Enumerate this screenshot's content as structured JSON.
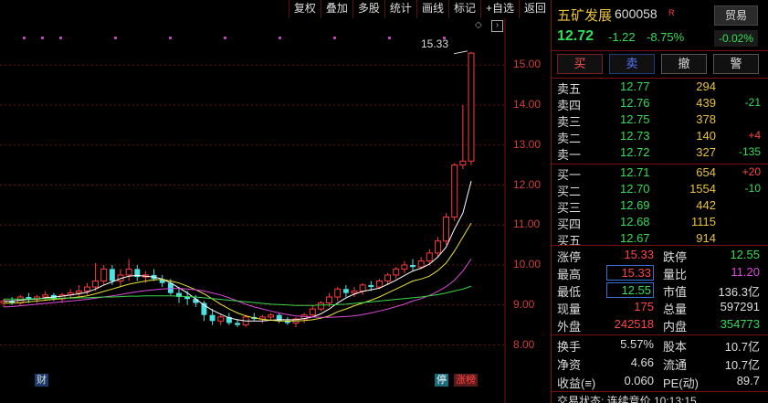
{
  "toolbar": [
    "复权",
    "叠加",
    "多股",
    "统计",
    "画线",
    "标记",
    "+自选",
    "返回"
  ],
  "chart_data": {
    "type": "candlestick",
    "ylim": [
      7.6,
      15.6
    ],
    "yticks": [
      "15.00",
      "14.00",
      "13.00",
      "12.00",
      "11.00",
      "10.00",
      "9.00",
      "8.00"
    ],
    "high_label": "15.33",
    "markers": {
      "cai": "财",
      "ting": "停",
      "zhangbang": "涨榜"
    },
    "ohlc": [
      [
        9.05,
        9.15,
        8.95,
        9.1
      ],
      [
        9.1,
        9.2,
        9.0,
        9.05
      ],
      [
        9.05,
        9.25,
        9.0,
        9.2
      ],
      [
        9.2,
        9.3,
        9.05,
        9.15
      ],
      [
        9.15,
        9.25,
        9.05,
        9.2
      ],
      [
        9.2,
        9.35,
        9.1,
        9.25
      ],
      [
        9.25,
        9.3,
        9.1,
        9.15
      ],
      [
        9.15,
        9.3,
        9.05,
        9.25
      ],
      [
        9.25,
        9.4,
        9.15,
        9.3
      ],
      [
        9.3,
        9.5,
        9.2,
        9.35
      ],
      [
        9.35,
        9.55,
        9.25,
        9.45
      ],
      [
        9.45,
        10.05,
        9.35,
        9.6
      ],
      [
        9.6,
        10.0,
        9.5,
        9.9
      ],
      [
        9.9,
        10.0,
        9.5,
        9.6
      ],
      [
        9.6,
        9.9,
        9.45,
        9.75
      ],
      [
        9.75,
        10.15,
        9.6,
        9.9
      ],
      [
        9.9,
        10.0,
        9.6,
        9.7
      ],
      [
        9.7,
        9.85,
        9.55,
        9.75
      ],
      [
        9.75,
        9.9,
        9.6,
        9.65
      ],
      [
        9.65,
        9.75,
        9.45,
        9.55
      ],
      [
        9.55,
        9.65,
        9.25,
        9.3
      ],
      [
        9.3,
        9.45,
        9.05,
        9.2
      ],
      [
        9.2,
        9.35,
        9.0,
        9.15
      ],
      [
        9.15,
        9.25,
        8.95,
        9.05
      ],
      [
        9.05,
        9.1,
        8.6,
        8.75
      ],
      [
        8.75,
        8.9,
        8.5,
        8.6
      ],
      [
        8.6,
        8.75,
        8.5,
        8.7
      ],
      [
        8.7,
        8.8,
        8.5,
        8.55
      ],
      [
        8.55,
        8.65,
        8.45,
        8.5
      ],
      [
        8.5,
        8.75,
        8.45,
        8.7
      ],
      [
        8.7,
        8.8,
        8.6,
        8.65
      ],
      [
        8.65,
        8.75,
        8.55,
        8.7
      ],
      [
        8.7,
        8.8,
        8.6,
        8.75
      ],
      [
        8.75,
        8.8,
        8.55,
        8.6
      ],
      [
        8.6,
        8.7,
        8.5,
        8.55
      ],
      [
        8.55,
        8.7,
        8.45,
        8.65
      ],
      [
        8.65,
        8.8,
        8.55,
        8.75
      ],
      [
        8.75,
        9.0,
        8.7,
        8.9
      ],
      [
        8.9,
        9.1,
        8.85,
        9.05
      ],
      [
        9.05,
        9.3,
        8.95,
        9.2
      ],
      [
        9.2,
        9.45,
        9.1,
        9.4
      ],
      [
        9.4,
        9.5,
        9.2,
        9.3
      ],
      [
        9.3,
        9.45,
        9.2,
        9.35
      ],
      [
        9.35,
        9.55,
        9.25,
        9.5
      ],
      [
        9.5,
        9.6,
        9.35,
        9.45
      ],
      [
        9.45,
        9.65,
        9.4,
        9.6
      ],
      [
        9.6,
        9.8,
        9.5,
        9.75
      ],
      [
        9.75,
        9.95,
        9.65,
        9.9
      ],
      [
        9.9,
        10.1,
        9.8,
        10.0
      ],
      [
        10.0,
        10.15,
        9.85,
        9.95
      ],
      [
        9.95,
        10.2,
        9.9,
        10.1
      ],
      [
        10.1,
        10.4,
        10.0,
        10.3
      ],
      [
        10.3,
        10.7,
        10.2,
        10.6
      ],
      [
        10.6,
        11.3,
        10.5,
        11.2
      ],
      [
        11.2,
        12.55,
        11.1,
        12.5
      ],
      [
        12.5,
        14.0,
        12.4,
        12.6
      ],
      [
        12.6,
        15.33,
        12.5,
        15.3
      ]
    ],
    "ma": {
      "ma5": {
        "color": "#ffffff",
        "values": [
          9.1,
          9.1,
          9.12,
          9.14,
          9.15,
          9.18,
          9.2,
          9.22,
          9.25,
          9.28,
          9.32,
          9.4,
          9.5,
          9.58,
          9.66,
          9.72,
          9.74,
          9.72,
          9.7,
          9.65,
          9.55,
          9.43,
          9.3,
          9.15,
          9.0,
          8.87,
          8.77,
          8.68,
          8.63,
          8.6,
          8.6,
          8.6,
          8.62,
          8.63,
          8.63,
          8.63,
          8.66,
          8.7,
          8.78,
          8.9,
          9.05,
          9.18,
          9.27,
          9.34,
          9.38,
          9.42,
          9.52,
          9.62,
          9.74,
          9.85,
          9.92,
          10.02,
          10.2,
          10.45,
          10.9,
          11.3,
          12.1
        ]
      },
      "ma10": {
        "color": "#e8e23a",
        "values": [
          9.05,
          9.05,
          9.06,
          9.08,
          9.1,
          9.12,
          9.14,
          9.16,
          9.18,
          9.2,
          9.23,
          9.28,
          9.34,
          9.4,
          9.46,
          9.52,
          9.56,
          9.6,
          9.63,
          9.64,
          9.6,
          9.55,
          9.47,
          9.38,
          9.28,
          9.15,
          9.02,
          8.9,
          8.8,
          8.73,
          8.68,
          8.64,
          8.62,
          8.6,
          8.6,
          8.6,
          8.61,
          8.63,
          8.67,
          8.73,
          8.83,
          8.9,
          8.98,
          9.05,
          9.12,
          9.2,
          9.3,
          9.4,
          9.5,
          9.6,
          9.65,
          9.72,
          9.86,
          10.05,
          10.35,
          10.7,
          11.05
        ]
      },
      "ma20": {
        "color": "#d94ad9",
        "values": [
          8.95,
          8.96,
          8.98,
          9.0,
          9.02,
          9.04,
          9.06,
          9.08,
          9.1,
          9.12,
          9.14,
          9.17,
          9.2,
          9.23,
          9.26,
          9.3,
          9.33,
          9.36,
          9.38,
          9.4,
          9.41,
          9.41,
          9.4,
          9.38,
          9.35,
          9.3,
          9.25,
          9.18,
          9.1,
          9.02,
          8.95,
          8.9,
          8.85,
          8.8,
          8.76,
          8.73,
          8.71,
          8.7,
          8.69,
          8.69,
          8.7,
          8.71,
          8.73,
          8.76,
          8.8,
          8.85,
          8.9,
          8.96,
          9.02,
          9.1,
          9.16,
          9.24,
          9.34,
          9.46,
          9.62,
          9.85,
          10.15
        ]
      },
      "ma60": {
        "color": "#3ad94a",
        "values": [
          9.15,
          9.15,
          9.15,
          9.15,
          9.16,
          9.16,
          9.16,
          9.17,
          9.17,
          9.18,
          9.18,
          9.19,
          9.2,
          9.2,
          9.21,
          9.22,
          9.22,
          9.23,
          9.23,
          9.23,
          9.23,
          9.22,
          9.21,
          9.2,
          9.18,
          9.16,
          9.14,
          9.12,
          9.1,
          9.08,
          9.06,
          9.04,
          9.02,
          9.01,
          9.0,
          8.99,
          8.99,
          8.99,
          9.0,
          9.0,
          9.01,
          9.02,
          9.04,
          9.06,
          9.08,
          9.1,
          9.12,
          9.14,
          9.16,
          9.18,
          9.2,
          9.23,
          9.26,
          9.3,
          9.35,
          9.4,
          9.47
        ]
      }
    }
  },
  "stock": {
    "name": "五矿发展",
    "code": "600058",
    "r_badge": "R",
    "price": "12.72",
    "change": "-1.22",
    "change_pct": "-8.75%",
    "trade_label": "贸易",
    "trade_pct": "-0.02%"
  },
  "actions": [
    "买",
    "卖",
    "撤",
    "警"
  ],
  "sell_book": [
    {
      "label": "卖五",
      "price": "12.77",
      "vol": "294",
      "chg": ""
    },
    {
      "label": "卖四",
      "price": "12.76",
      "vol": "439",
      "chg": "-21"
    },
    {
      "label": "卖三",
      "price": "12.75",
      "vol": "378",
      "chg": ""
    },
    {
      "label": "卖二",
      "price": "12.73",
      "vol": "140",
      "chg": "+4"
    },
    {
      "label": "卖一",
      "price": "12.72",
      "vol": "327",
      "chg": "-135"
    }
  ],
  "buy_book": [
    {
      "label": "买一",
      "price": "12.71",
      "vol": "654",
      "chg": "+20"
    },
    {
      "label": "买二",
      "price": "12.70",
      "vol": "1554",
      "chg": "-10"
    },
    {
      "label": "买三",
      "price": "12.69",
      "vol": "442",
      "chg": ""
    },
    {
      "label": "买四",
      "price": "12.68",
      "vol": "1115",
      "chg": ""
    },
    {
      "label": "买五",
      "price": "12.67",
      "vol": "914",
      "chg": ""
    }
  ],
  "stats1": [
    {
      "l1": "涨停",
      "v1": "15.33",
      "c1": "#ff4444",
      "b1": false,
      "l2": "跌停",
      "v2": "12.55",
      "c2": "#33dd55",
      "b2": false
    },
    {
      "l1": "最高",
      "v1": "15.33",
      "c1": "#ff4444",
      "b1": true,
      "l2": "量比",
      "v2": "11.20",
      "c2": "#d94ad9",
      "b2": false
    },
    {
      "l1": "最低",
      "v1": "12.55",
      "c1": "#33dd55",
      "b1": true,
      "l2": "市值",
      "v2": "136.3亿",
      "c2": "#dddddd",
      "b2": false
    },
    {
      "l1": "现量",
      "v1": "175",
      "c1": "#ff4444",
      "b1": false,
      "l2": "总量",
      "v2": "597291",
      "c2": "#dddddd",
      "b2": false
    },
    {
      "l1": "外盘",
      "v1": "242518",
      "c1": "#ff4444",
      "b1": false,
      "l2": "内盘",
      "v2": "354773",
      "c2": "#33dd55",
      "b2": false
    }
  ],
  "stats2": [
    {
      "l1": "换手",
      "v1": "5.57%",
      "l2": "股本",
      "v2": "10.7亿"
    },
    {
      "l1": "净资",
      "v1": "4.66",
      "l2": "流通",
      "v2": "10.7亿"
    },
    {
      "l1": "收益(≡)",
      "v1": "0.060",
      "l2": "PE(动)",
      "v2": "89.7"
    }
  ],
  "status": "交易状态: 连续竞价 10:13:15"
}
